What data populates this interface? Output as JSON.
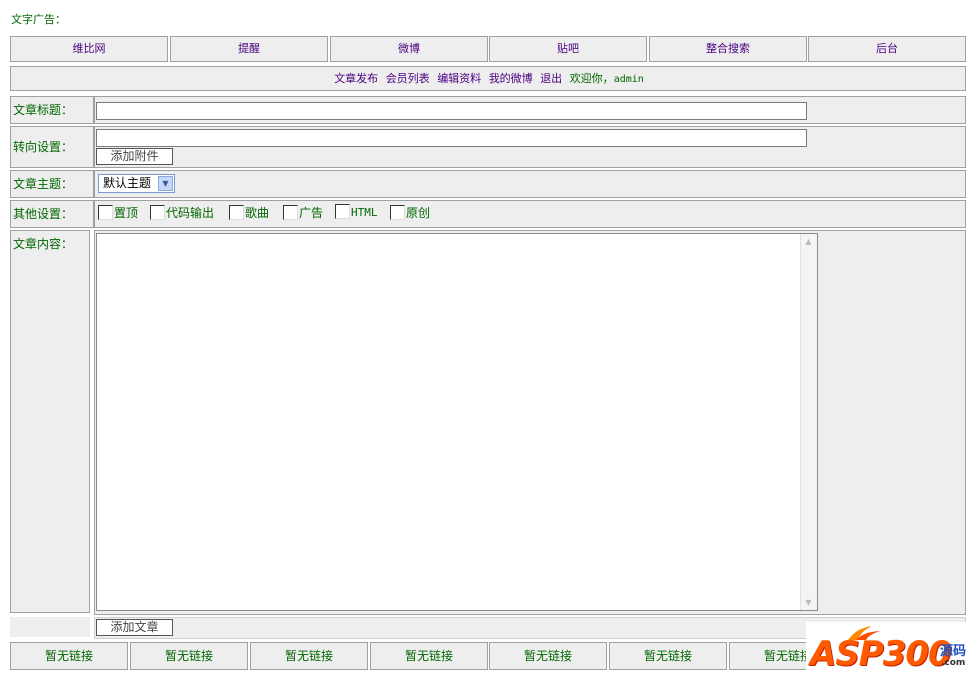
{
  "ad": {
    "label": "文字广告："
  },
  "nav": {
    "items": [
      "维比网",
      "提醒",
      "微博",
      "贴吧",
      "整合搜索",
      "后台"
    ]
  },
  "subnav": {
    "links": [
      "文章发布",
      "会员列表",
      "编辑资料",
      "我的微博",
      "退出"
    ],
    "welcome": "欢迎你，",
    "user": "admin"
  },
  "form": {
    "title_label": "文章标题：",
    "title_value": "",
    "redirect_label": "转向设置：",
    "redirect_value": "",
    "attach_button": "添加附件",
    "topic_label": "文章主题：",
    "topic_selected": "默认主题",
    "other_label": "其他设置：",
    "options": [
      {
        "label": "置顶",
        "checked": false
      },
      {
        "label": "代码输出",
        "checked": false
      },
      {
        "label": "歌曲",
        "checked": false
      },
      {
        "label": "广告",
        "checked": false
      },
      {
        "label": "HTML",
        "checked": false
      },
      {
        "label": "原创",
        "checked": false
      }
    ],
    "content_label": "文章内容：",
    "content_value": "",
    "submit_button": "添加文章"
  },
  "footer": {
    "links": [
      "暂无链接",
      "暂无链接",
      "暂无链接",
      "暂无链接",
      "暂无链接",
      "暂无链接",
      "暂无链接"
    ]
  },
  "watermark": {
    "brand": "ASP300",
    "cn": "源码",
    "domain": ".com"
  }
}
